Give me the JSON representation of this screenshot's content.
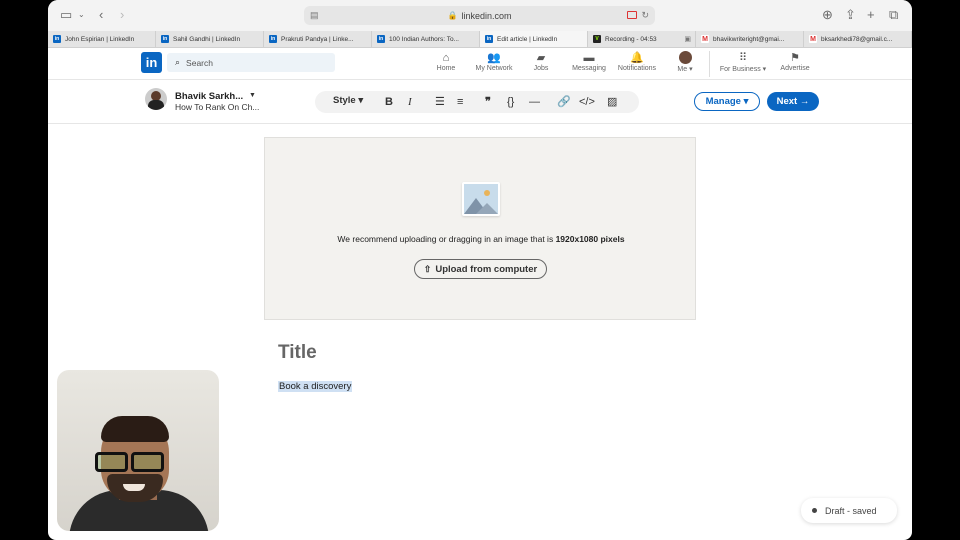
{
  "browser": {
    "url": "linkedin.com",
    "icons": [
      "sidebar-icon",
      "back-icon",
      "forward-icon",
      "download-icon",
      "share-icon",
      "new-tab-icon",
      "tabs-overview-icon"
    ]
  },
  "tabs": [
    {
      "label": "John Espirian | LinkedIn",
      "favicon": "in"
    },
    {
      "label": "Sahil Gandhi | LinkedIn",
      "favicon": "in"
    },
    {
      "label": "Prakruti Pandya | Linke...",
      "favicon": "in"
    },
    {
      "label": "100 Indian Authors: To...",
      "favicon": "in"
    },
    {
      "label": "Edit article | LinkedIn",
      "favicon": "in",
      "active": true
    },
    {
      "label": "Recording - 04:53",
      "favicon": "V"
    },
    {
      "label": "bhavikwriteright@gmai...",
      "favicon": "M"
    },
    {
      "label": "bksarkhedi78@gmail.c...",
      "favicon": "M"
    }
  ],
  "linkedin_nav": {
    "logo": "in",
    "search_placeholder": "Search",
    "items": [
      {
        "label": "Home",
        "icon": "home-icon"
      },
      {
        "label": "My Network",
        "icon": "network-icon"
      },
      {
        "label": "Jobs",
        "icon": "briefcase-icon"
      },
      {
        "label": "Messaging",
        "icon": "message-icon"
      },
      {
        "label": "Notifications",
        "icon": "bell-icon"
      },
      {
        "label": "Me ▾",
        "icon": "avatar"
      },
      {
        "label": "For Business ▾",
        "icon": "grid-icon"
      },
      {
        "label": "Advertise",
        "icon": "advertise-icon"
      }
    ]
  },
  "editor": {
    "author_name": "Bhavik Sarkh...",
    "author_sub": "How To Rank On Ch...",
    "style_label": "Style",
    "manage_label": "Manage",
    "next_label": "Next →",
    "toolbar_icons": [
      "bold-icon",
      "italic-icon",
      "bullet-list-icon",
      "numbered-list-icon",
      "quote-icon",
      "code-block-icon",
      "divider-icon",
      "link-icon",
      "embed-icon",
      "image-icon"
    ]
  },
  "cover": {
    "text_prefix": "We recommend uploading or dragging in an image that is ",
    "text_bold": "1920x1080 pixels",
    "upload_label": "Upload from computer"
  },
  "article": {
    "title_placeholder": "Title",
    "body_text": "Book a discovery"
  },
  "status": {
    "draft_label": "Draft - saved"
  }
}
